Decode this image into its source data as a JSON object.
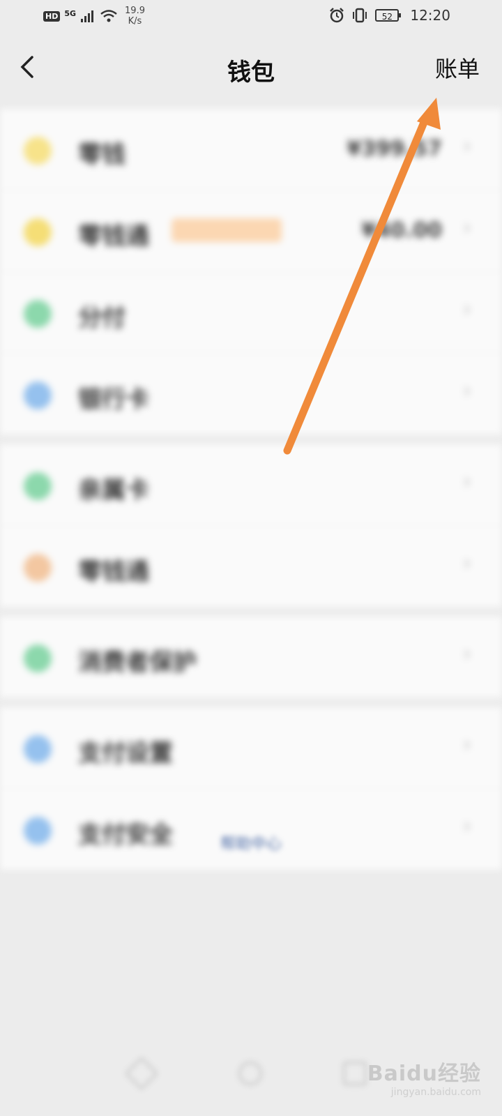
{
  "status_bar": {
    "hd": "HD",
    "network": "5G",
    "speed_value": "19.9",
    "speed_unit": "K/s",
    "battery": "52",
    "time": "12:20"
  },
  "header": {
    "title": "钱包",
    "bill_label": "账单"
  },
  "groups": [
    [
      {
        "label": "零钱",
        "value": "¥399.57",
        "icon_color": "#f5d95a",
        "icon": "coin-icon"
      },
      {
        "label": "零钱通",
        "badge": "",
        "value": "¥40.00",
        "icon_color": "#f2d13d",
        "icon": "diamond-icon"
      },
      {
        "label": "分付",
        "icon_color": "#5cc98a",
        "icon": "installment-icon"
      },
      {
        "label": "银行卡",
        "icon_color": "#6aa8e8",
        "icon": "card-icon"
      }
    ],
    [
      {
        "label": "亲属卡",
        "icon_color": "#5cc98a",
        "icon": "family-card-icon"
      },
      {
        "label": "零钱通",
        "icon_color": "#f0b07a",
        "icon": "clock-icon"
      }
    ],
    [
      {
        "label": "消费者保护",
        "icon_color": "#5cc98a",
        "icon": "shield-icon"
      }
    ],
    [
      {
        "label": "支付设置",
        "icon_color": "#6aa8e8",
        "icon": "settings-icon"
      },
      {
        "label": "支付安全",
        "icon_color": "#6aa8e8",
        "icon": "security-icon"
      }
    ]
  ],
  "footer_link": "帮助中心",
  "watermark": {
    "main": "Baidu经验",
    "sub": "jingyan.baidu.com"
  },
  "annotation": {
    "color": "#f08a3a"
  }
}
